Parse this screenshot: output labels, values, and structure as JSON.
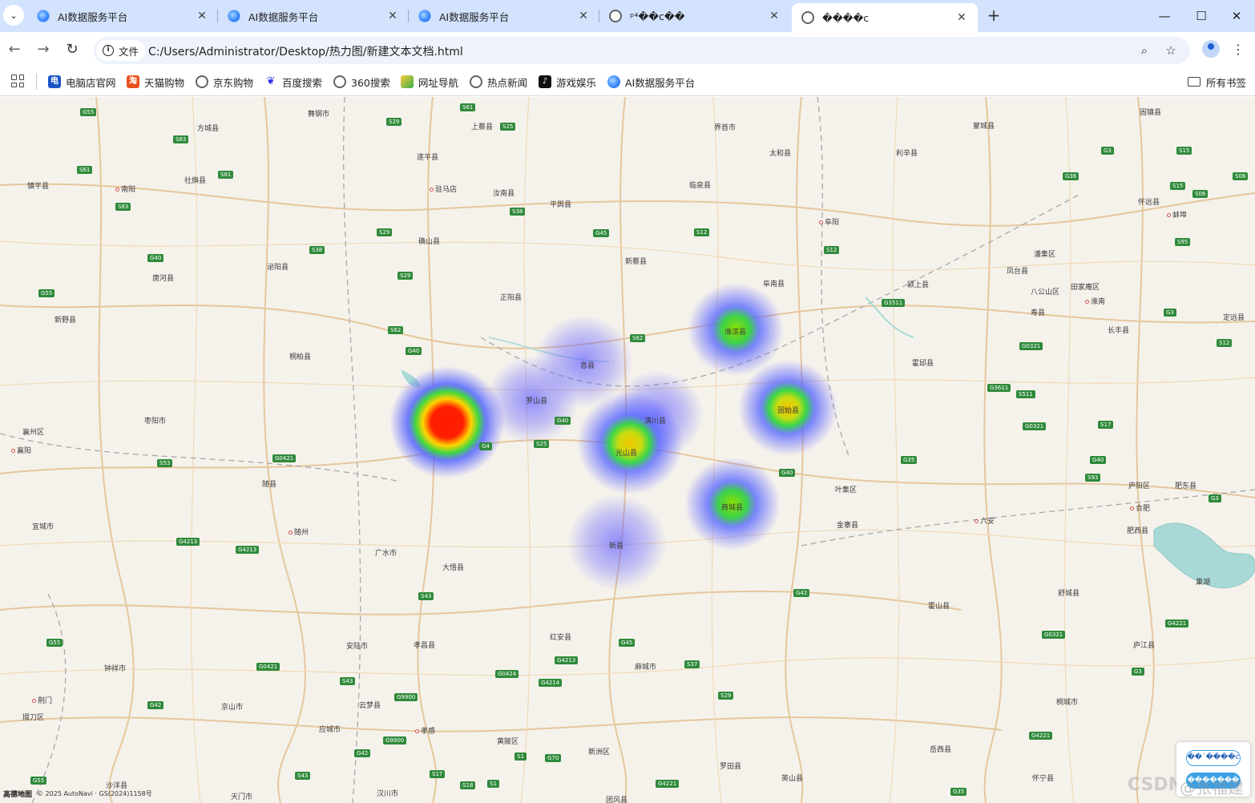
{
  "tabs": [
    {
      "title": "AI数据服务平台",
      "icon": "ai-favicon"
    },
    {
      "title": "AI数据服务平台",
      "icon": "ai-favicon"
    },
    {
      "title": "AI数据服务平台",
      "icon": "ai-favicon"
    },
    {
      "title": "ᵖ⁴��c��",
      "icon": "globe-icon"
    },
    {
      "title": "����c",
      "icon": "globe-icon",
      "active": true
    }
  ],
  "toolbar": {
    "chip_label": "文件",
    "url": "C:/Users/Administrator/Desktop/热力图/新建文本文档.html"
  },
  "bookmarks": {
    "items": [
      {
        "label": "电脑店官网",
        "glyph": "电"
      },
      {
        "label": "天猫购物",
        "glyph": "淘"
      },
      {
        "label": "京东购物",
        "glyph": ""
      },
      {
        "label": "百度搜索",
        "glyph": "❦"
      },
      {
        "label": "360搜索",
        "glyph": ""
      },
      {
        "label": "网址导航",
        "glyph": ""
      },
      {
        "label": "热点新闻",
        "glyph": ""
      },
      {
        "label": "游戏娱乐",
        "glyph": "♪"
      },
      {
        "label": "AI数据服务平台",
        "glyph": ""
      }
    ],
    "all_label": "所有书签"
  },
  "map": {
    "places": [
      {
        "name": "舞钢市"
      },
      {
        "name": "上蔡县"
      },
      {
        "name": "方城县"
      },
      {
        "name": "遂平县"
      },
      {
        "name": "驻马店"
      },
      {
        "name": "汝南县"
      },
      {
        "name": "社旗县"
      },
      {
        "name": "南阳"
      },
      {
        "name": "镇平县"
      },
      {
        "name": "平舆县"
      },
      {
        "name": "确山县"
      },
      {
        "name": "唐河县"
      },
      {
        "name": "泌阳县"
      },
      {
        "name": "新野县"
      },
      {
        "name": "正阳县"
      },
      {
        "name": "桐柏县"
      },
      {
        "name": "息县"
      },
      {
        "name": "罗山县"
      },
      {
        "name": "枣阳市"
      },
      {
        "name": "襄州区"
      },
      {
        "name": "襄阳"
      },
      {
        "name": "随县"
      },
      {
        "name": "随州"
      },
      {
        "name": "宜城市"
      },
      {
        "name": "广水市"
      },
      {
        "name": "大悟县"
      },
      {
        "name": "新县"
      },
      {
        "name": "潢川县"
      },
      {
        "name": "光山县"
      },
      {
        "name": "商城县"
      },
      {
        "name": "淮滨县"
      },
      {
        "name": "固始县"
      },
      {
        "name": "新蔡县"
      },
      {
        "name": "临泉县"
      },
      {
        "name": "界首市"
      },
      {
        "name": "太和县"
      },
      {
        "name": "阜阳"
      },
      {
        "name": "阜南县"
      },
      {
        "name": "霍邱县"
      },
      {
        "name": "利辛县"
      },
      {
        "name": "蒙城县"
      },
      {
        "name": "颍上县"
      },
      {
        "name": "凤台县"
      },
      {
        "name": "潘集区"
      },
      {
        "name": "淮南"
      },
      {
        "name": "寿县"
      },
      {
        "name": "八公山区"
      },
      {
        "name": "田家庵区"
      },
      {
        "name": "长丰县"
      },
      {
        "name": "定远县"
      },
      {
        "name": "怀远县"
      },
      {
        "name": "蚌埠"
      },
      {
        "name": "固镇县"
      },
      {
        "name": "叶集区"
      },
      {
        "name": "金寨县"
      },
      {
        "name": "六安"
      },
      {
        "name": "庐阳区"
      },
      {
        "name": "合肥"
      },
      {
        "name": "肥东县"
      },
      {
        "name": "肥西县"
      },
      {
        "name": "巢湖"
      },
      {
        "name": "舒城县"
      },
      {
        "name": "霍山县"
      },
      {
        "name": "庐江县"
      },
      {
        "name": "红安县"
      },
      {
        "name": "麻城市"
      },
      {
        "name": "孝昌县"
      },
      {
        "name": "安陆市"
      },
      {
        "name": "钟祥市"
      },
      {
        "name": "京山市"
      },
      {
        "name": "荆门"
      },
      {
        "name": "掇刀区"
      },
      {
        "name": "云梦县"
      },
      {
        "name": "孝感"
      },
      {
        "name": "应城市"
      },
      {
        "name": "黄陂区"
      },
      {
        "name": "新洲区"
      },
      {
        "name": "罗田县"
      },
      {
        "name": "英山县"
      },
      {
        "name": "岳西县"
      },
      {
        "name": "怀宁县"
      },
      {
        "name": "桐城市"
      },
      {
        "name": "沙洋县"
      },
      {
        "name": "天门市"
      },
      {
        "name": "汉川市"
      },
      {
        "name": "团风县"
      }
    ],
    "copyright_logo": "高德地图",
    "copyright_text": "© 2025 AutoNavi · GS(2024)1158号",
    "watermark_brand": "CSDN",
    "watermark_user": "@张福建",
    "control_top": "��ˊ����c",
    "control_bottom": "�������"
  },
  "heatmap": {
    "type": "heatmap",
    "points": [
      {
        "place": "桐柏县",
        "intensity": 1.0
      },
      {
        "place": "光山县",
        "intensity": 0.75
      },
      {
        "place": "淮滨县",
        "intensity": 0.7
      },
      {
        "place": "固始县",
        "intensity": 0.7
      },
      {
        "place": "商城县",
        "intensity": 0.6
      },
      {
        "place": "罗山县",
        "intensity": 0.35
      },
      {
        "place": "息县",
        "intensity": 0.3
      },
      {
        "place": "潢川县",
        "intensity": 0.35
      },
      {
        "place": "新县",
        "intensity": 0.3
      }
    ],
    "colors": {
      "low": "#4040ff",
      "mid": "#3cd24a",
      "high": "#ff1a00"
    }
  }
}
